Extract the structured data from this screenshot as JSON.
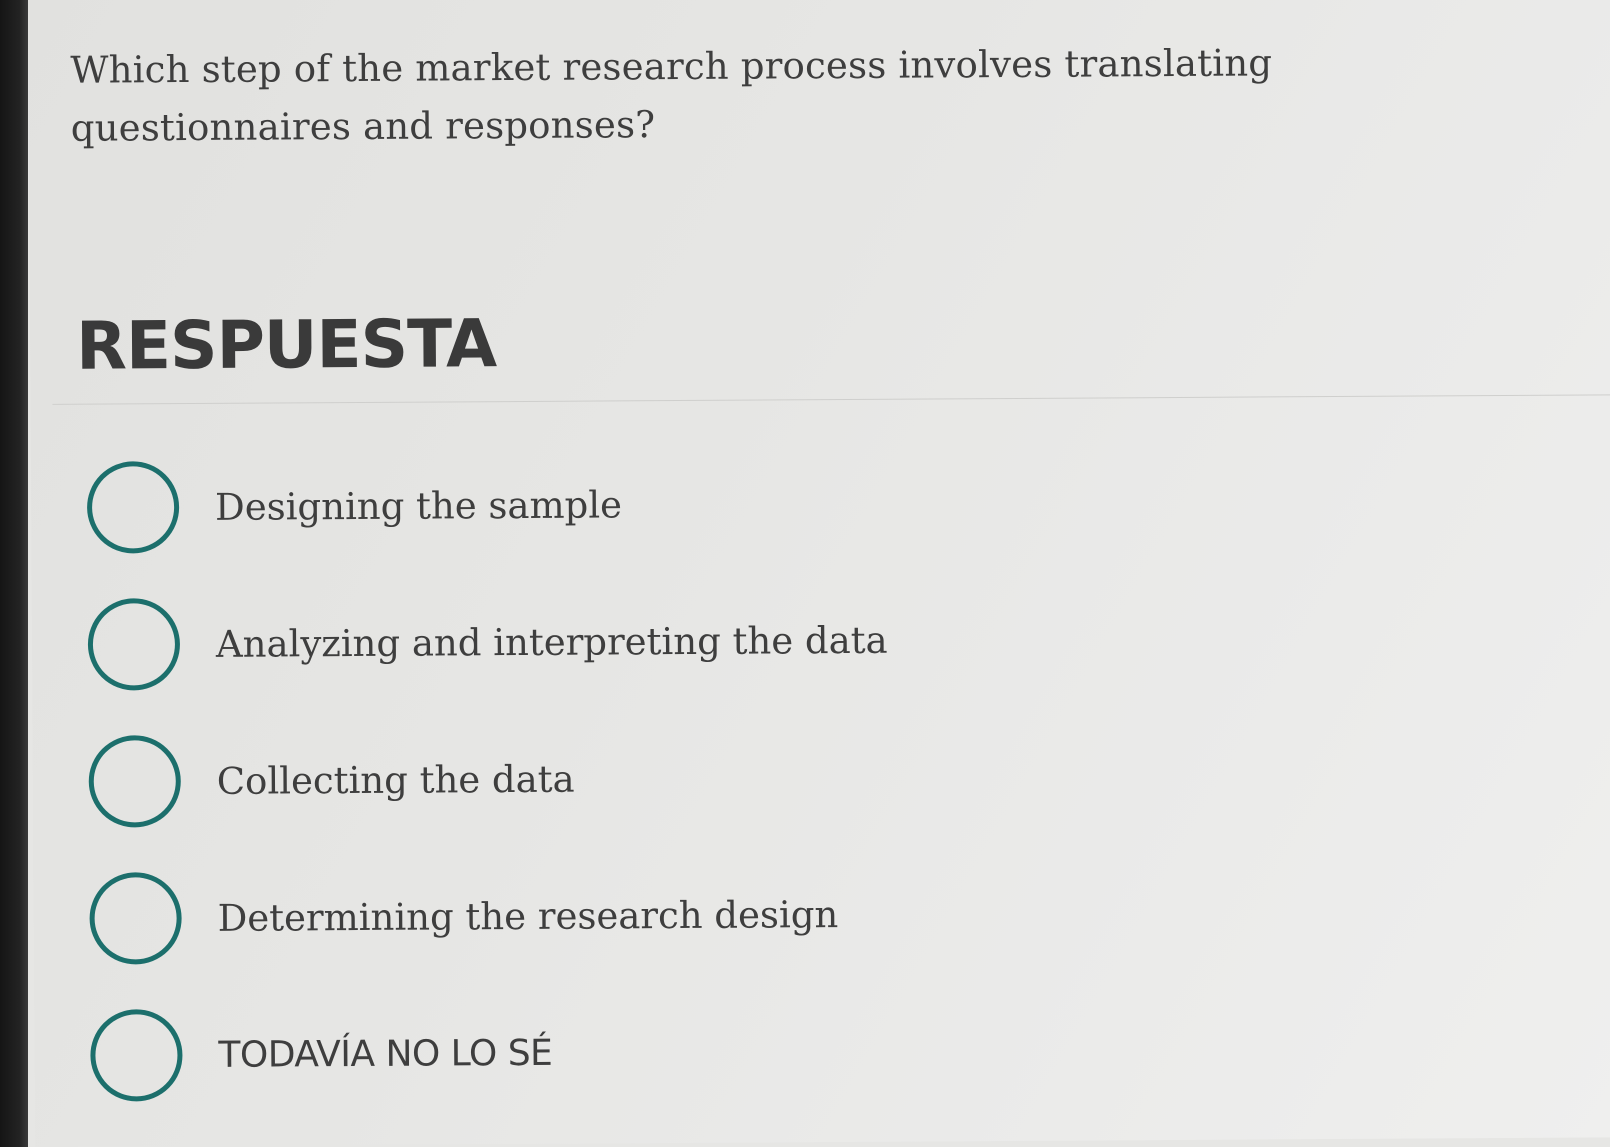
{
  "question": {
    "text": "Which step of the market research process involves translating questionnaires and responses?"
  },
  "answer_section": {
    "heading": "RESPUESTA"
  },
  "options": [
    {
      "label": "Designing the sample",
      "selected": false
    },
    {
      "label": "Analyzing and interpreting the data",
      "selected": false
    },
    {
      "label": "Collecting the data",
      "selected": false
    },
    {
      "label": "Determining the research design",
      "selected": false
    },
    {
      "label": "TODAVÍA NO LO SÉ",
      "selected": false
    }
  ],
  "colors": {
    "radio_border": "#1c6f6c",
    "text": "#3e3e3e",
    "background": "#e6e6e4"
  }
}
